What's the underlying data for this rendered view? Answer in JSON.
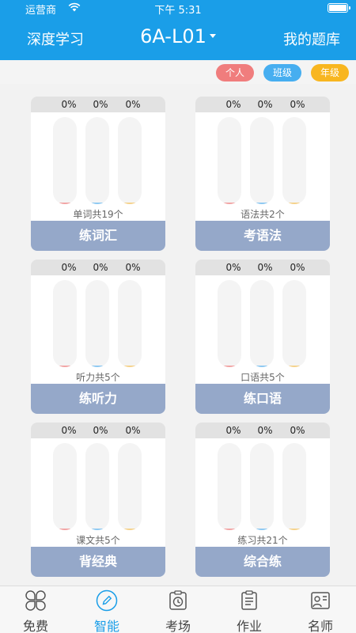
{
  "status_bar": {
    "carrier": "运营商",
    "time": "下午 5:31"
  },
  "nav": {
    "left": "深度学习",
    "title": "6A-L01",
    "right": "我的题库"
  },
  "filters": [
    {
      "label": "个人",
      "color": "#f07d7d"
    },
    {
      "label": "班级",
      "color": "#46aef0"
    },
    {
      "label": "年级",
      "color": "#f8b620"
    }
  ],
  "cards": [
    {
      "percents": [
        "0%",
        "0%",
        "0%"
      ],
      "count": "单词共19个",
      "title": "练词汇"
    },
    {
      "percents": [
        "0%",
        "0%",
        "0%"
      ],
      "count": "语法共2个",
      "title": "考语法"
    },
    {
      "percents": [
        "0%",
        "0%",
        "0%"
      ],
      "count": "听力共5个",
      "title": "练听力"
    },
    {
      "percents": [
        "0%",
        "0%",
        "0%"
      ],
      "count": "口语共5个",
      "title": "练口语"
    },
    {
      "percents": [
        "0%",
        "0%",
        "0%"
      ],
      "count": "课文共5个",
      "title": "背经典"
    },
    {
      "percents": [
        "0%",
        "0%",
        "0%"
      ],
      "count": "练习共21个",
      "title": "综合练"
    }
  ],
  "tabs": [
    {
      "label": "免费",
      "icon": "clover-icon",
      "active": false
    },
    {
      "label": "智能",
      "icon": "pencil-circle-icon",
      "active": true
    },
    {
      "label": "考场",
      "icon": "clock-icon",
      "active": false
    },
    {
      "label": "作业",
      "icon": "clipboard-icon",
      "active": false
    },
    {
      "label": "名师",
      "icon": "teacher-icon",
      "active": false
    }
  ],
  "colors": {
    "primary": "#1a9ee8",
    "card_button": "#95a8c9"
  }
}
